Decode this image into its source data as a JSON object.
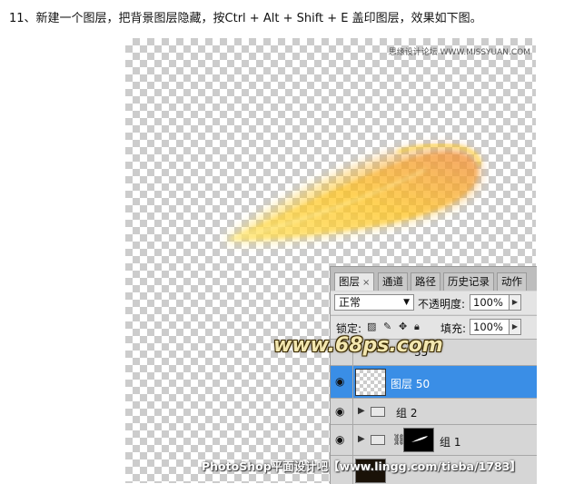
{
  "instruction": "11、新建一个图层，把背景图层隐藏，按Ctrl + Alt + Shift + E 盖印图层，效果如下图。",
  "site_watermark": "思缘设计论坛 WWW.MISSYUAN.COM",
  "colors": {
    "selected_layer": "#3a8ee6",
    "feather_yellow": "#ffd21a",
    "feather_orange": "#f0883a"
  },
  "panel": {
    "tabs": [
      {
        "label": "图层",
        "close": "×"
      },
      {
        "label": "通道"
      },
      {
        "label": "路径"
      },
      {
        "label": "历史记录"
      },
      {
        "label": "动作"
      }
    ],
    "blend_mode": "正常",
    "opacity_label": "不透明度:",
    "opacity_value": "100%",
    "lock_label": "锁定:",
    "fill_label": "填充:",
    "fill_value": "100%",
    "layers": [
      {
        "name": "35",
        "partial": true
      },
      {
        "name": "图层 50",
        "selected": true,
        "visible": true
      },
      {
        "name": "组 2",
        "type": "group",
        "visible": true
      },
      {
        "name": "组 1",
        "type": "group",
        "visible": true,
        "has_mask": true
      }
    ]
  },
  "overlay_logo": "www.68ps.com",
  "bottom_watermark": "PhotoShop平面设计吧【www.lingg.com/tieba/1783】"
}
